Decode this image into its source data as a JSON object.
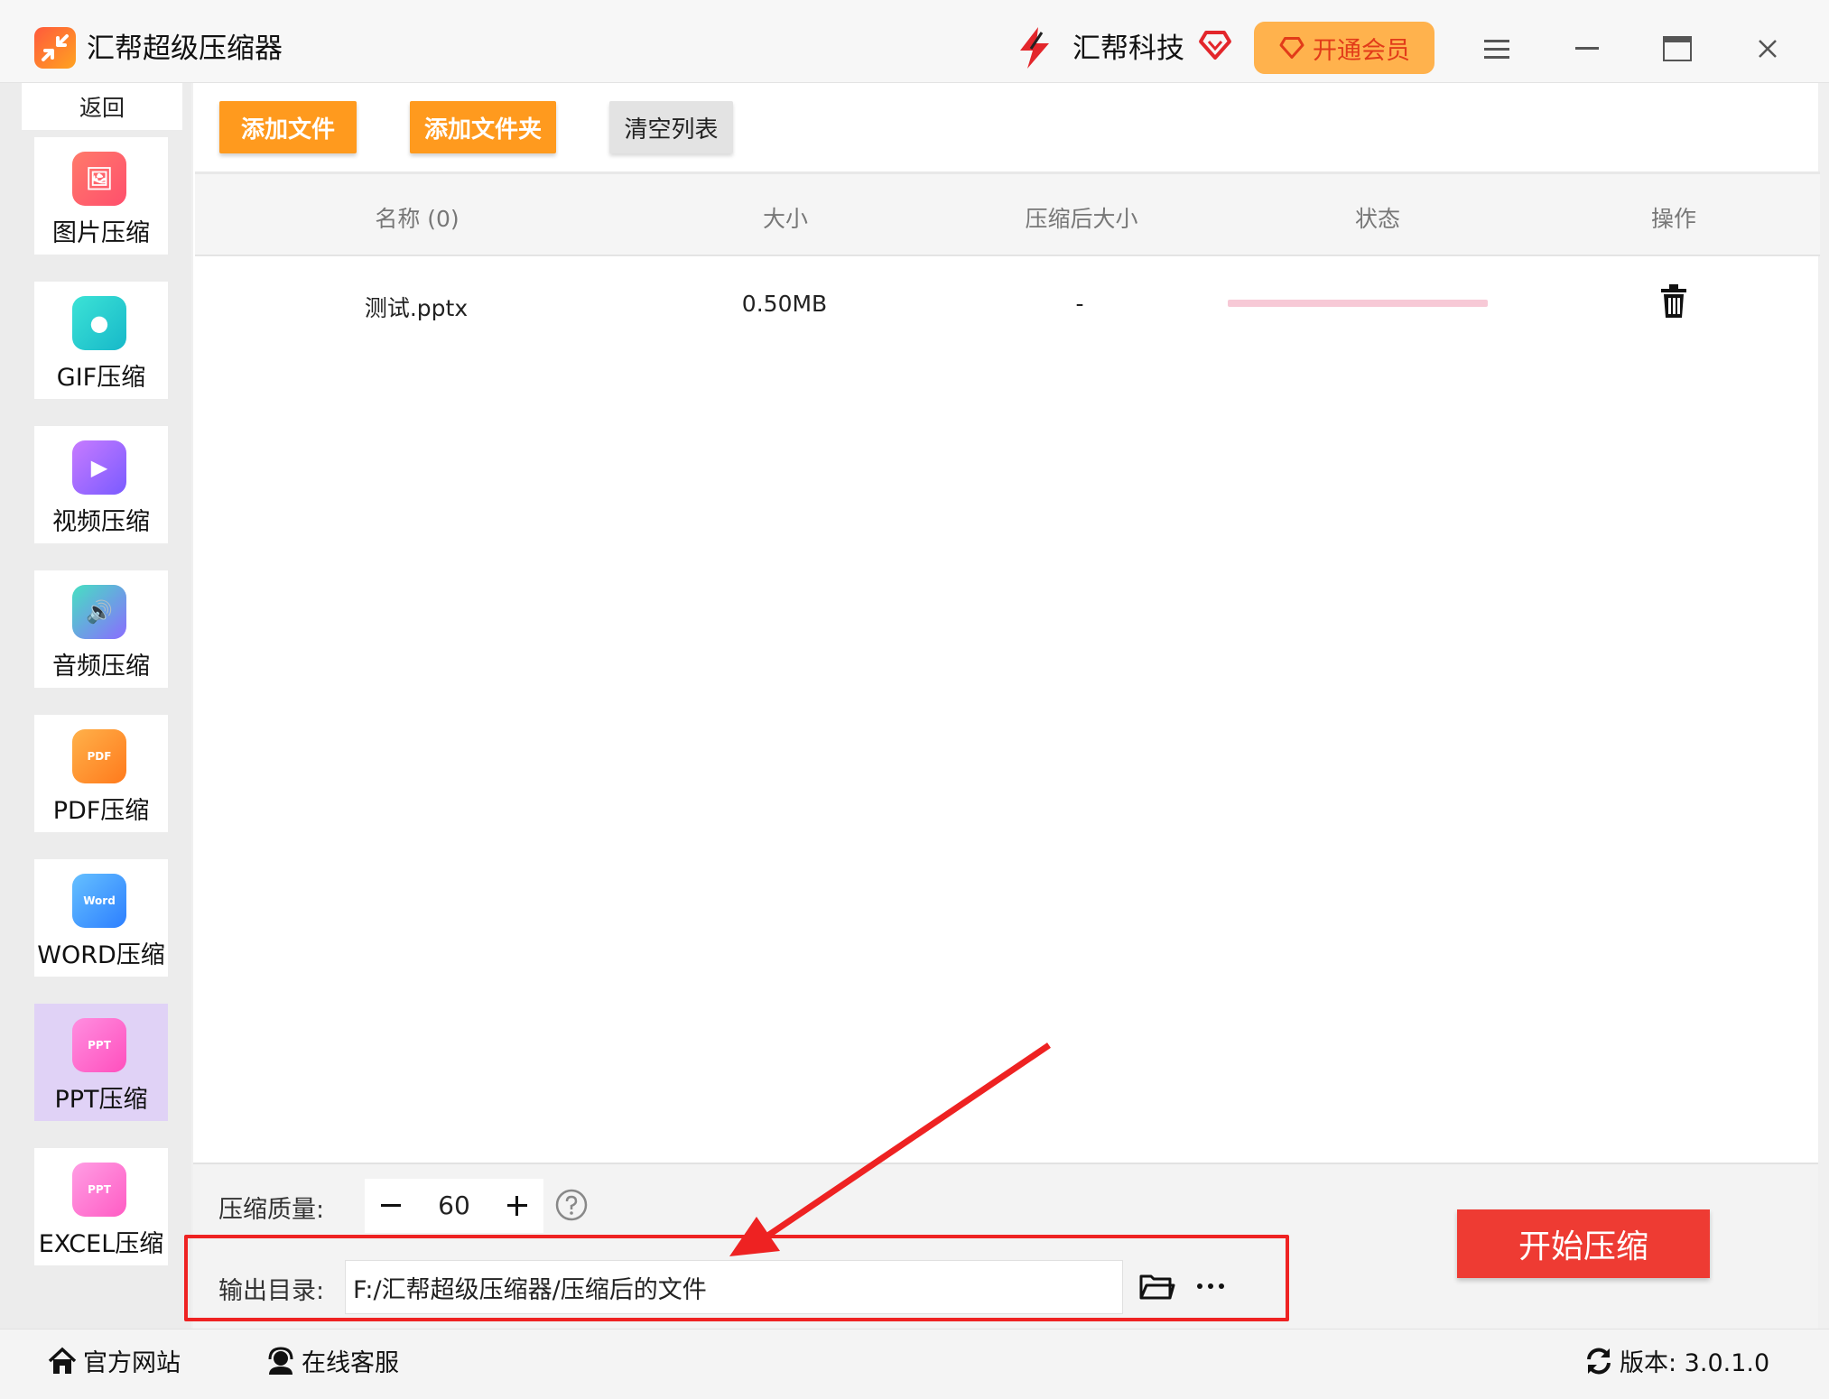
{
  "app": {
    "title": "汇帮超级压缩器",
    "brand_name": "汇帮科技",
    "vip_label": "开通会员",
    "accent_color": "#ff9a1e",
    "start_color": "#ee3b33"
  },
  "sidebar": {
    "back_label": "返回",
    "items": [
      {
        "label": "图片压缩",
        "icon": "image-icon",
        "color1": "#ff7a6a",
        "color2": "#ff4f6d",
        "glyph": "🖼"
      },
      {
        "label": "GIF压缩",
        "icon": "gif-icon",
        "color1": "#3ce3d6",
        "color2": "#17b8c9",
        "glyph": "●"
      },
      {
        "label": "视频压缩",
        "icon": "video-icon",
        "color1": "#c77bff",
        "color2": "#7a5bff",
        "glyph": "▶"
      },
      {
        "label": "音频压缩",
        "icon": "audio-icon",
        "color1": "#46e0c2",
        "color2": "#8a6cff",
        "glyph": "🔊"
      },
      {
        "label": "PDF压缩",
        "icon": "pdf-icon",
        "color1": "#ffb14a",
        "color2": "#ff7a1c",
        "glyph": "PDF"
      },
      {
        "label": "WORD压缩",
        "icon": "word-icon",
        "color1": "#65c0ff",
        "color2": "#2d7fff",
        "glyph": "Word"
      },
      {
        "label": "PPT压缩",
        "icon": "ppt-icon",
        "color1": "#ff8ee0",
        "color2": "#ff4fbd",
        "glyph": "PPT"
      },
      {
        "label": "EXCEL压缩",
        "icon": "excel-icon",
        "color1": "#ff9ee4",
        "color2": "#ff5cc4",
        "glyph": "PPT"
      }
    ],
    "active_index": 6
  },
  "toolbar": {
    "add_file": "添加文件",
    "add_folder": "添加文件夹",
    "clear_list": "清空列表"
  },
  "table": {
    "headers": [
      "名称 (0)",
      "大小",
      "压缩后大小",
      "状态",
      "操作"
    ],
    "rows": [
      {
        "name": "测试.pptx",
        "size": "0.50MB",
        "compressed_size": "-",
        "status_progress": 0
      }
    ]
  },
  "settings": {
    "quality_label": "压缩质量:",
    "quality_value": "60",
    "output_label": "输出目录:",
    "output_path": "F:/汇帮超级压缩器/压缩后的文件",
    "start_label": "开始压缩"
  },
  "footer": {
    "website": "官方网站",
    "support": "在线客服",
    "version": "版本: 3.0.1.0"
  }
}
